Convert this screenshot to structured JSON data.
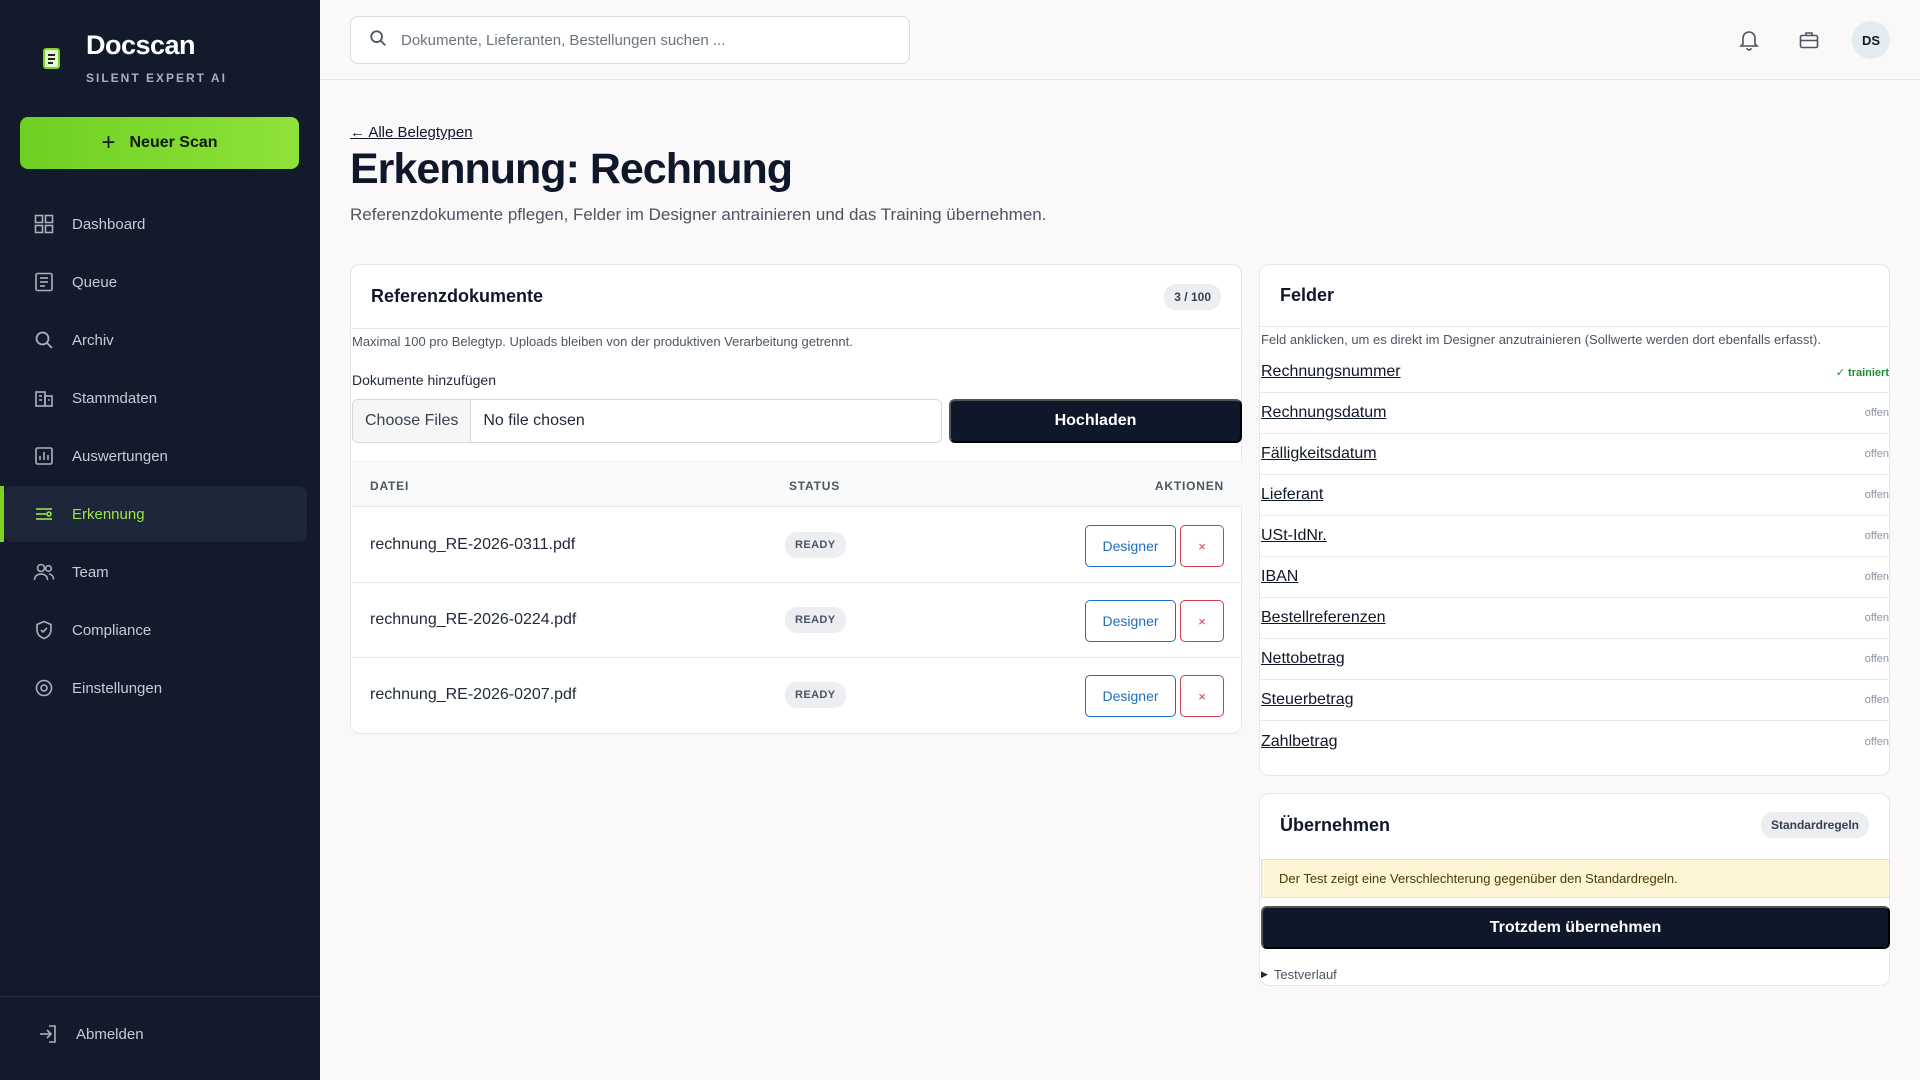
{
  "app": {
    "name": "Docscan",
    "tagline": "SILENT EXPERT AI",
    "new_scan_label": "Neuer Scan",
    "accent": "#7ed321",
    "sidebar_bg": "#121a2b"
  },
  "nav": {
    "items": [
      {
        "label": "Dashboard",
        "icon": "grid-icon"
      },
      {
        "label": "Queue",
        "icon": "list-icon"
      },
      {
        "label": "Archiv",
        "icon": "search-icon"
      },
      {
        "label": "Stammdaten",
        "icon": "building-icon"
      },
      {
        "label": "Auswertungen",
        "icon": "chart-icon"
      },
      {
        "label": "Erkennung",
        "icon": "sliders-icon",
        "active": true
      },
      {
        "label": "Team",
        "icon": "users-icon"
      },
      {
        "label": "Compliance",
        "icon": "shield-icon"
      },
      {
        "label": "Einstellungen",
        "icon": "gear-icon"
      }
    ],
    "logout_label": "Abmelden"
  },
  "topbar": {
    "search_placeholder": "Dokumente, Lieferanten, Bestellungen suchen ...",
    "avatar_initials": "DS"
  },
  "header": {
    "back_link": "← Alle Belegtypen",
    "title": "Erkennung: Rechnung",
    "subtitle": "Referenzdokumente pflegen, Felder im Designer antrainieren und das Training übernehmen."
  },
  "references": {
    "title": "Referenzdokumente",
    "count": "3 / 100",
    "note": "Maximal 100 pro Belegtyp. Uploads bleiben von der produktiven Verarbeitung getrennt.",
    "add_label": "Dokumente hinzufügen",
    "choose_files": "Choose Files",
    "no_file": "No file chosen",
    "upload_label": "Hochladen",
    "columns": {
      "file": "DATEI",
      "status": "STATUS",
      "actions": "AKTIONEN"
    },
    "rows": [
      {
        "file": "rechnung_RE-2026-0311.pdf",
        "status": "READY",
        "designer": "Designer",
        "delete": "×"
      },
      {
        "file": "rechnung_RE-2026-0224.pdf",
        "status": "READY",
        "designer": "Designer",
        "delete": "×"
      },
      {
        "file": "rechnung_RE-2026-0207.pdf",
        "status": "READY",
        "designer": "Designer",
        "delete": "×"
      }
    ]
  },
  "fields": {
    "title": "Felder",
    "note": "Feld anklicken, um es direkt im Designer anzutrainieren (Sollwerte werden dort ebenfalls erfasst).",
    "items": [
      {
        "label": "Rechnungsnummer",
        "state": "✓ trainiert"
      },
      {
        "label": "Rechnungsdatum",
        "state": "offen"
      },
      {
        "label": "Fälligkeitsdatum",
        "state": "offen"
      },
      {
        "label": "Lieferant",
        "state": "offen"
      },
      {
        "label": "USt-IdNr.",
        "state": "offen"
      },
      {
        "label": "IBAN",
        "state": "offen"
      },
      {
        "label": "Bestellreferenzen",
        "state": "offen"
      },
      {
        "label": "Nettobetrag",
        "state": "offen"
      },
      {
        "label": "Steuerbetrag",
        "state": "offen"
      },
      {
        "label": "Zahlbetrag",
        "state": "offen"
      }
    ]
  },
  "adopt": {
    "title": "Übernehmen",
    "badge": "Standardregeln",
    "warning": "Der Test zeigt eine Verschlechterung gegenüber den Standardregeln.",
    "button": "Trotzdem übernehmen",
    "history": "Testverlauf"
  }
}
